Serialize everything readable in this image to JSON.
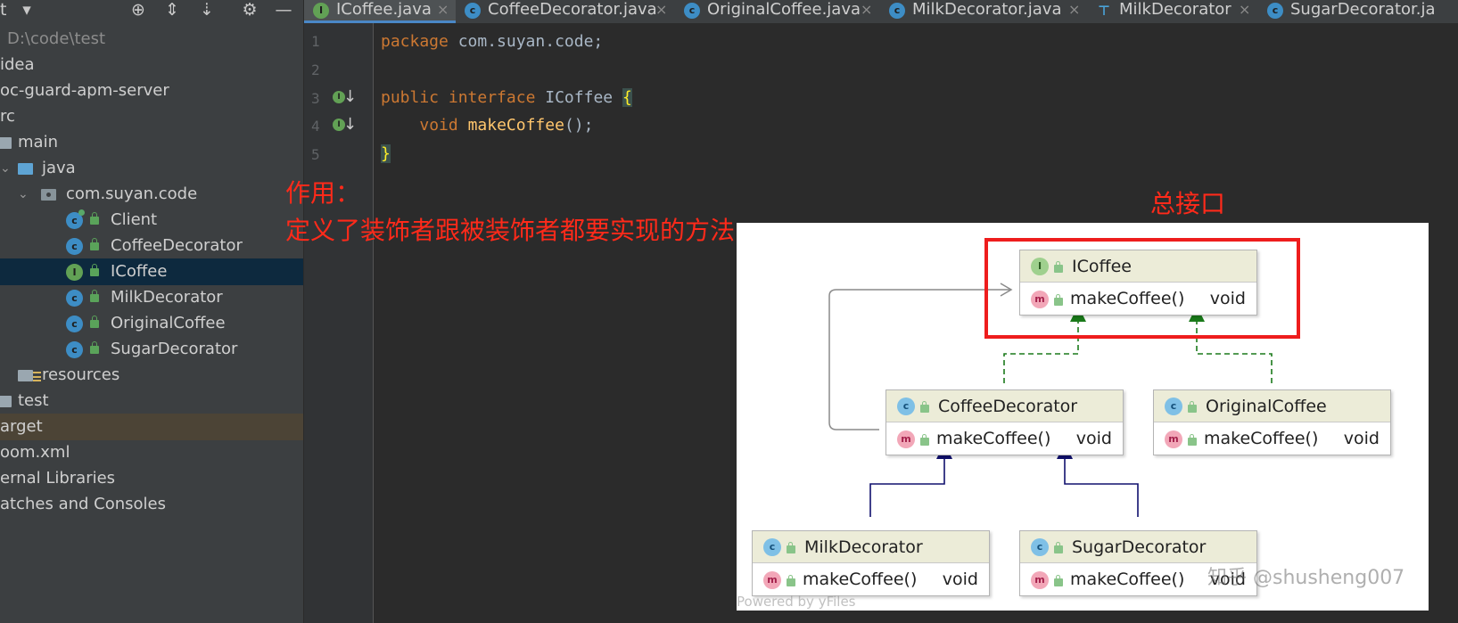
{
  "project": {
    "toolbar_title": "t",
    "path": "D:\\code\\test",
    "tree": [
      {
        "label": "idea"
      },
      {
        "label": "oc-guard-apm-server"
      },
      {
        "label": "rc"
      },
      {
        "label": "main"
      },
      {
        "label": "java"
      },
      {
        "label": "com.suyan.code"
      },
      {
        "label": "Client"
      },
      {
        "label": "CoffeeDecorator"
      },
      {
        "label": "ICoffee"
      },
      {
        "label": "MilkDecorator"
      },
      {
        "label": "OriginalCoffee"
      },
      {
        "label": "SugarDecorator"
      },
      {
        "label": "resources"
      },
      {
        "label": "test"
      },
      {
        "label": "arget"
      },
      {
        "label": "oom.xml"
      },
      {
        "label": "ernal Libraries"
      },
      {
        "label": "atches and Consoles"
      }
    ]
  },
  "tabs": [
    {
      "label": "ICoffee.java",
      "icon": "interface-icon",
      "close": "×"
    },
    {
      "label": "CoffeeDecorator.java",
      "icon": "class-icon",
      "close": "×"
    },
    {
      "label": "OriginalCoffee.java",
      "icon": "class-icon",
      "close": "×"
    },
    {
      "label": "MilkDecorator.java",
      "icon": "class-icon",
      "close": "×"
    },
    {
      "label": "MilkDecorator",
      "icon": "diagram-icon",
      "close": "×"
    },
    {
      "label": "SugarDecorator.ja",
      "icon": "class-icon",
      "close": ""
    }
  ],
  "editor": {
    "line_numbers": [
      "1",
      "2",
      "3",
      "4",
      "5"
    ],
    "code": {
      "l1_kw": "package",
      "l1_rest": " com.suyan.code;",
      "l3_kw1": "public",
      "l3_kw2": "interface",
      "l3_name": " ICoffee ",
      "l3_brace": "{",
      "l4_indent": "    ",
      "l4_kw": "void",
      "l4_fn": "makeCoffee",
      "l4_rest": "();",
      "l5_brace": "}"
    }
  },
  "annotations": {
    "purpose_title": "作用：",
    "purpose_text": "定义了装饰者跟被装饰者都要实现的方法",
    "root_label": "总接口"
  },
  "diagram": {
    "boxes": {
      "icoffee": {
        "name": "ICoffee",
        "method": "makeCoffee()",
        "ret": "void"
      },
      "coffee_decorator": {
        "name": "CoffeeDecorator",
        "method": "makeCoffee()",
        "ret": "void"
      },
      "original_coffee": {
        "name": "OriginalCoffee",
        "method": "makeCoffee()",
        "ret": "void"
      },
      "milk_decorator": {
        "name": "MilkDecorator",
        "method": "makeCoffee()",
        "ret": "void"
      },
      "sugar_decorator": {
        "name": "SugarDecorator",
        "method": "makeCoffee()",
        "ret": "void"
      }
    },
    "watermark": "知乎 @shusheng007",
    "powered_by": "Powered by yFiles"
  },
  "icons": {
    "class_letter": "c",
    "interface_letter": "I",
    "method_letter": "m"
  },
  "colors": {
    "accent_red": "#ff2a1a",
    "realization_green": "#1a7a1a",
    "inheritance_navy": "#10106e"
  }
}
